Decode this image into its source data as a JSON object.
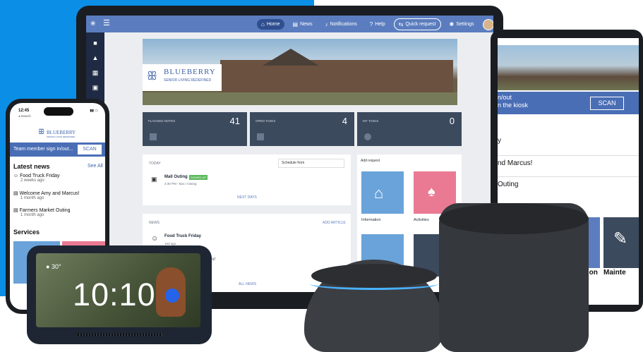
{
  "laptop": {
    "nav": {
      "home": "Home",
      "news": "News",
      "notifications": "Notifications",
      "help": "Help",
      "quick_request": "Quick request",
      "settings": "Settings"
    },
    "brand": {
      "name": "BLUEBERRY",
      "tagline": "SENIOR LIVING REDEFINED"
    },
    "stats": [
      {
        "label": "FLAGGED NOTES",
        "value": "41"
      },
      {
        "label": "OPEN TASKS",
        "value": "4"
      },
      {
        "label": "MY TASKS",
        "value": "0"
      }
    ],
    "today": {
      "header": "TODAY",
      "schedule_label": "Schedule from",
      "event_title": "Mall Outing",
      "event_badge": "SIGNED UP",
      "event_sub": "2:30 PM - Bus / Outing",
      "next_days": "NEXT DAYS"
    },
    "news": {
      "header": "NEWS",
      "add_article": "ADD ARTICLE",
      "item1_title": "Food Truck Friday",
      "item1_sub": "16d ago",
      "item2_title": "rcus!",
      "all_news": "ALL NEWS"
    },
    "requests": {
      "label": "Add request",
      "tiles": [
        "Information",
        "Activities"
      ]
    }
  },
  "tablet": {
    "scan_text_line1": "n/out",
    "scan_text_line2": "n the kiosk",
    "scan_button": "SCAN",
    "rows": [
      "y",
      "nd Marcus!",
      "Outing"
    ],
    "tiles": [
      "ation",
      "Mainte"
    ]
  },
  "phone": {
    "time": "12:45",
    "back_label": "◂ Search",
    "brand_name": "BLUEBERRY",
    "brand_sub": "SENIOR LIVING REDEFINED",
    "scan_text": "Team member sign in/out...",
    "scan_button": "SCAN",
    "latest_news": "Latest news",
    "see_all": "See All",
    "items": [
      {
        "title": "Food Truck Friday",
        "sub": "2 weeks ago"
      },
      {
        "title": "Welcome Amy and Marcus!",
        "sub": "1 month ago"
      },
      {
        "title": "Farmers Market Outing",
        "sub": "1 month ago"
      }
    ],
    "services": "Services"
  },
  "echo_show": {
    "temp": "30°",
    "time": "10:10"
  },
  "colors": {
    "brand_blue": "#5b7dbf",
    "scan_blue": "#4a6eb5",
    "background_blue": "#0b8fe6",
    "stat_dark": "#3c4a5e"
  }
}
